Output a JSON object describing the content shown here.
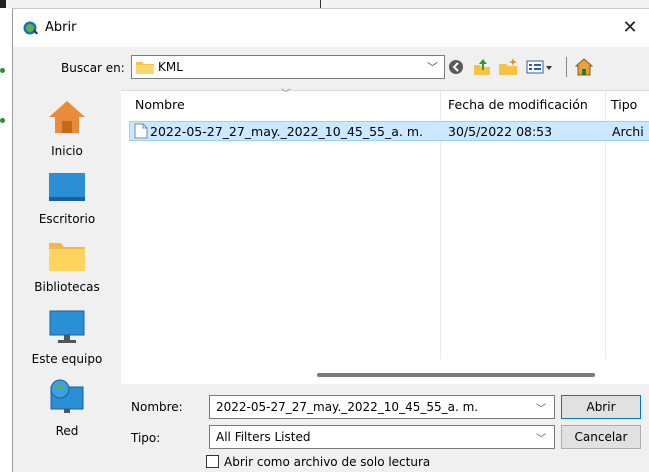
{
  "window": {
    "title": "Abrir",
    "close_glyph": "✕"
  },
  "lookin": {
    "label": "Buscar en:",
    "value": "KML"
  },
  "toolbar": {
    "icons": [
      "back-icon",
      "up-folder-icon",
      "new-folder-icon",
      "view-menu-icon",
      "home-icon"
    ]
  },
  "places": [
    {
      "label": "Inicio",
      "icon": "home-icon"
    },
    {
      "label": "Escritorio",
      "icon": "desktop-icon"
    },
    {
      "label": "Bibliotecas",
      "icon": "libraries-folder-icon"
    },
    {
      "label": "Este equipo",
      "icon": "computer-icon"
    },
    {
      "label": "Red",
      "icon": "network-icon"
    }
  ],
  "file_list": {
    "columns": [
      "Nombre",
      "Fecha de modificación",
      "Tipo"
    ],
    "rows": [
      {
        "name": "2022-05-27_27_may._2022_10_45_55_a. m.",
        "date": "30/5/2022 08:53",
        "type": "Archi"
      }
    ]
  },
  "filename": {
    "label": "Nombre:",
    "value": "2022-05-27_27_may._2022_10_45_55_a. m."
  },
  "filetype": {
    "label": "Tipo:",
    "value": "All Filters Listed"
  },
  "buttons": {
    "open": "Abrir",
    "cancel": "Cancelar"
  },
  "readonly_label": "Abrir como archivo de solo lectura",
  "colors": {
    "selection": "#cce8ff",
    "accent": "#0078d7",
    "folder": "#f6c445"
  }
}
